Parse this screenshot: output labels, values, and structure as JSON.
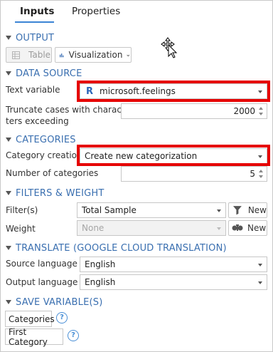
{
  "tabs": [
    {
      "label": "Inputs",
      "active": true
    },
    {
      "label": "Properties",
      "active": false
    }
  ],
  "output": {
    "title": "OUTPUT",
    "table_label": "Table",
    "visualization_label": "Visualization"
  },
  "data_source": {
    "title": "DATA SOURCE",
    "text_variable_label": "Text variable",
    "text_variable_value": "microsoft.feelings",
    "truncate_label_line1": "Truncate cases with charac-",
    "truncate_label_line2": "ters exceeding",
    "truncate_value": "2000"
  },
  "categories": {
    "title": "CATEGORIES",
    "creation_label": "Category creation",
    "creation_value": "Create new categorization",
    "number_label": "Number of categories",
    "number_value": "5"
  },
  "filters": {
    "title": "FILTERS & WEIGHT",
    "filter_label": "Filter(s)",
    "filter_value": "Total Sample",
    "filter_new_label": "New",
    "weight_label": "Weight",
    "weight_value": "None",
    "weight_new_label": "New"
  },
  "translate": {
    "title": "TRANSLATE (GOOGLE CLOUD TRANSLATION)",
    "source_label": "Source language",
    "source_value": "English",
    "output_label": "Output language",
    "output_value": "English"
  },
  "save": {
    "title": "SAVE VARIABLE(S)",
    "categories_button": "Categories",
    "first_category_button": "First Category"
  },
  "colors": {
    "accent_blue": "#3b84d4",
    "section_blue": "#3a6fb0",
    "highlight_red": "#e60000"
  },
  "icons": {
    "r_logo": "R",
    "help": "?"
  }
}
